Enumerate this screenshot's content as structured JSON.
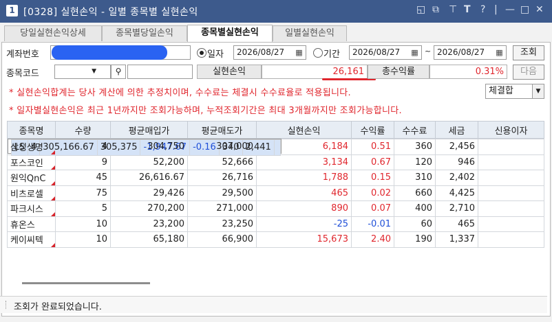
{
  "window": {
    "number": "1",
    "title": "[0328] 실현손익 - 일별 종목별 실현손익",
    "colors": {
      "titlebar": "#3d5a8c",
      "positive": "#e0262d",
      "negative": "#1f4fd8"
    }
  },
  "tabs": [
    {
      "label": "당일실현손익상세"
    },
    {
      "label": "종목별당일손익"
    },
    {
      "label": "종목별실현손익"
    },
    {
      "label": "일별실현손익"
    }
  ],
  "form": {
    "account_label": "계좌번호",
    "radio_day_label": "일자",
    "date_day": "2026/08/27",
    "radio_period_label": "기간",
    "date_from": "2026/08/27",
    "tilde": "~",
    "date_to": "2026/08/27",
    "query_button": "조회",
    "stock_code_label": "종목코드",
    "realized_label": "실현손익",
    "realized_value": "26,161",
    "return_label": "총수익률",
    "return_value": "0.31%",
    "next_button": "다음",
    "settle_select": "체결합"
  },
  "notes": [
    "* 실현손익합계는 당사 계산에 의한 추정치이며, 수수료는 체결시 수수료율로 적용됩니다.",
    "* 일자별실현손익은 최근 1년까지만 조회가능하며, 누적조회기간은 최대 3개월까지만 조회가능합니다."
  ],
  "table": {
    "headers": [
      "종목명",
      "수량",
      "평균매입가",
      "평균매도가",
      "실현손익",
      "수익률",
      "수수료",
      "세금",
      "신용이자"
    ],
    "rows": [
      {
        "name": "LS",
        "qty": "4",
        "buy": "305,166.67",
        "sell": "305,375",
        "pnl": "-1,947.67",
        "rate": "-0.16",
        "fee": "340",
        "tax": "2,441",
        "interest": ""
      },
      {
        "name": "삼성생명",
        "qty": "4",
        "buy": "304,750",
        "sell": "307,000",
        "pnl": "6,184",
        "rate": "0.51",
        "fee": "360",
        "tax": "2,456",
        "interest": ""
      },
      {
        "name": "포스코인",
        "qty": "9",
        "buy": "52,200",
        "sell": "52,666",
        "pnl": "3,134",
        "rate": "0.67",
        "fee": "120",
        "tax": "946",
        "interest": ""
      },
      {
        "name": "원익QnC",
        "qty": "45",
        "buy": "26,616.67",
        "sell": "26,716",
        "pnl": "1,788",
        "rate": "0.15",
        "fee": "310",
        "tax": "2,402",
        "interest": ""
      },
      {
        "name": "비츠로셀",
        "qty": "75",
        "buy": "29,426",
        "sell": "29,500",
        "pnl": "465",
        "rate": "0.02",
        "fee": "660",
        "tax": "4,425",
        "interest": ""
      },
      {
        "name": "파크시스",
        "qty": "5",
        "buy": "270,200",
        "sell": "271,000",
        "pnl": "890",
        "rate": "0.07",
        "fee": "400",
        "tax": "2,710",
        "interest": ""
      },
      {
        "name": "휴온스",
        "qty": "10",
        "buy": "23,200",
        "sell": "23,250",
        "pnl": "-25",
        "rate": "-0.01",
        "fee": "60",
        "tax": "465",
        "interest": ""
      },
      {
        "name": "케이씨텍",
        "qty": "10",
        "buy": "65,180",
        "sell": "66,900",
        "pnl": "15,673",
        "rate": "2.40",
        "fee": "190",
        "tax": "1,337",
        "interest": ""
      }
    ]
  },
  "status": {
    "message": "조회가 완료되었습니다."
  }
}
